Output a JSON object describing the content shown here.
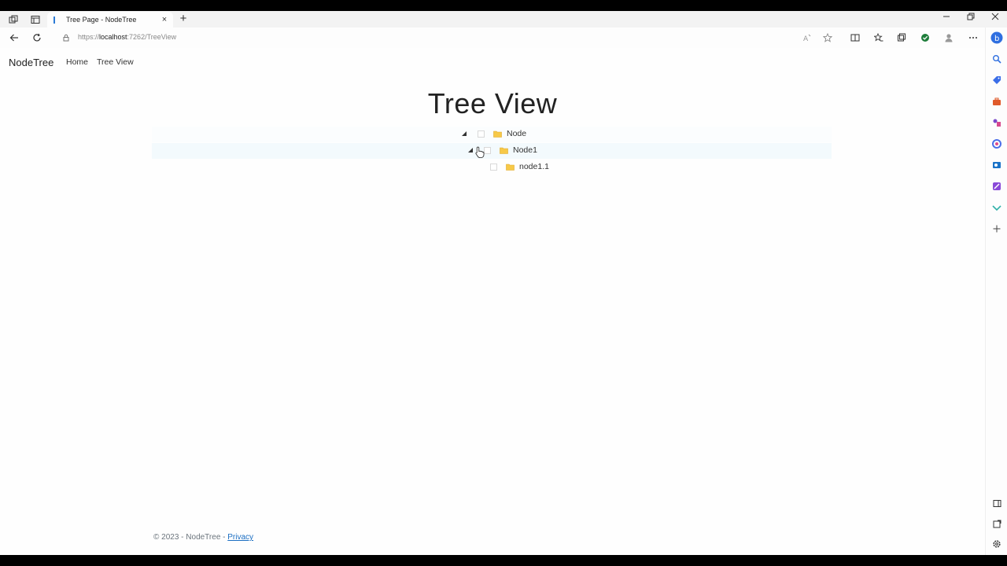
{
  "browser": {
    "tab_title": "Tree Page - NodeTree",
    "url_prefix": "https://",
    "url_host": "localhost",
    "url_path": ":7262/TreeView",
    "new_tab": "+",
    "close_tab": "×"
  },
  "nav": {
    "brand": "NodeTree",
    "links": [
      "Home",
      "Tree View"
    ]
  },
  "main": {
    "title": "Tree View",
    "tree": [
      {
        "label": "Node",
        "level": 0,
        "expanded": true,
        "checked": false
      },
      {
        "label": "Node1",
        "level": 1,
        "expanded": true,
        "checked": false
      },
      {
        "label": "node1.1",
        "level": 2,
        "expanded": false,
        "checked": false
      }
    ]
  },
  "footer": {
    "text": "© 2023 - NodeTree - ",
    "privacy": "Privacy"
  },
  "colors": {
    "folder": "#f7c948",
    "link": "#1b6ec2",
    "row_hover": "#f3fafd"
  },
  "icons": {
    "sidebar": [
      "copilot-icon",
      "search-icon",
      "shopping-tag-icon",
      "toolbox-icon",
      "games-icon",
      "office-icon",
      "outlook-icon",
      "designer-icon",
      "drop-icon",
      "add-icon"
    ]
  }
}
